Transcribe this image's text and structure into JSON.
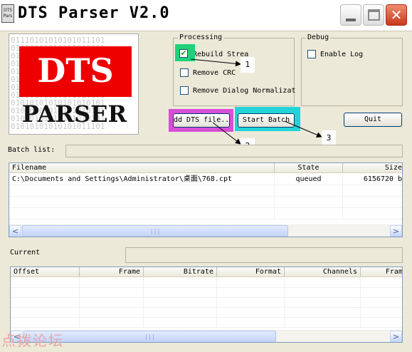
{
  "window": {
    "title": "DTS Parser V2.0",
    "icon_text": "DTS Pars",
    "min_icon": "minimize-icon",
    "max_icon": "maximize-icon",
    "close_icon": "close-icon",
    "close_glyph": "✕"
  },
  "logo": {
    "top_text": "DTS",
    "bottom_text": "PARSER",
    "binary_rows": [
      "01110101010101011101",
      "01010101010101010101",
      "01010101010101010101",
      "01010101010101010101",
      "01010101010101010101",
      "01010101010101010101",
      "01010101010101010101",
      "01010101010101010101",
      "01010101010101010101",
      "01010101010101010101",
      "01010101010101010101",
      "01010101010101011101"
    ],
    "colors": {
      "red": "#ef0000",
      "text": "#ffffff"
    }
  },
  "processing": {
    "label": "Processing",
    "options": [
      {
        "label": "Rebuild Strea",
        "checked": true,
        "check_glyph": "✔"
      },
      {
        "label": "Remove CRC",
        "checked": false,
        "check_glyph": ""
      },
      {
        "label": "Remove Dialog Normalizat",
        "checked": false,
        "check_glyph": ""
      }
    ]
  },
  "debug": {
    "label": "Debug",
    "options": [
      {
        "label": "Enable Log",
        "checked": false,
        "check_glyph": ""
      }
    ]
  },
  "buttons": {
    "add_dts": "dd DTS file...",
    "start_batch": "Start Batch",
    "quit": "Quit"
  },
  "annotations": {
    "callouts": [
      "1",
      "2",
      "3"
    ],
    "colors": {
      "green": "#1fd27a",
      "magenta": "#d64fd6",
      "cyan": "#22d3d8"
    }
  },
  "batch": {
    "label": "Batch list:",
    "columns": [
      "Filename",
      "State",
      "Size"
    ],
    "rows": [
      {
        "filename": "C:\\Documents and Settings\\Administrator\\桌面\\768.cpt",
        "state": "queued",
        "size": "6156720 b"
      }
    ]
  },
  "current": {
    "label": "Current",
    "columns": [
      "Offset",
      "Frame",
      "Bitrate",
      "Format",
      "Channels",
      "Frame"
    ]
  },
  "scrollbar": {
    "left_glyph": "<",
    "right_glyph": ">",
    "thumb_grip": "|||"
  },
  "watermark": "点拨论坛"
}
